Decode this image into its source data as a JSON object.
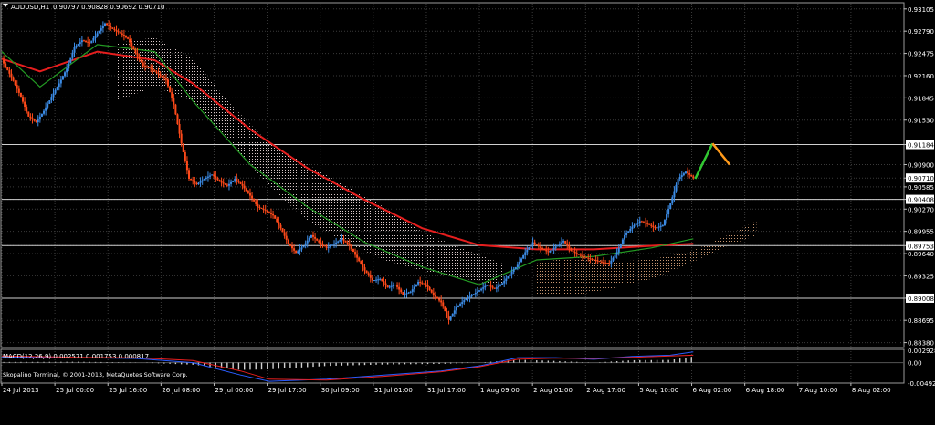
{
  "colors": {
    "background": "#000000",
    "grid": "#3a3a3a",
    "axis_text": "#ffffff",
    "bull_candle": "#3c8ce6",
    "bear_candle": "#ff4a1a",
    "ma_slow": "#e61e1e",
    "ma_fast": "#239b23",
    "ichimoku_cloud_bear": "#d8c8c8",
    "ichimoku_cloud_bull": "#c89670",
    "horizontal_level": "#d0d0d0",
    "macd_line": "#2a5cff",
    "macd_signal": "#e61e1e",
    "macd_histogram": "#d0d0d0",
    "arrow_up": "#20e020",
    "arrow_down": "#e02020",
    "forecast_up": "#32c832",
    "forecast_down": "#ff9a1a"
  },
  "header": {
    "symbol_label": "AUDUSD,H1",
    "ohlc_label": "0.90797 0.90828 0.90692 0.90710",
    "symbol_icon": "triangle-down-icon"
  },
  "footer": {
    "copyright": "Skopalino Terminal, © 2001-2013, MetaQuotes Software Corp."
  },
  "chart_data": [
    {
      "type": "candlestick",
      "symbol": "AUDUSD",
      "timeframe": "H1",
      "price_ticks": [
        "0.93105",
        "0.92790",
        "0.92475",
        "0.92160",
        "0.91845",
        "0.91530",
        "0.91184",
        "0.90900",
        "0.90710",
        "0.90585",
        "0.90408",
        "0.90270",
        "0.89955",
        "0.89753",
        "0.89640",
        "0.89325",
        "0.89008",
        "0.88695",
        "0.88380"
      ],
      "highlighted_ticks": [
        "0.91184",
        "0.90710",
        "0.90408",
        "0.89753",
        "0.89008"
      ],
      "highlighted_tick_colors": [
        "#ffffff",
        "#ffffff",
        "#ffffff",
        "#ffffff",
        "#ffffff"
      ],
      "horizontal_levels": [
        0.91184,
        0.90408,
        0.89753,
        0.89008
      ],
      "ylim": [
        0.8831,
        0.9318
      ],
      "time_ticks": [
        "24 Jul 2013",
        "25 Jul 00:00",
        "25 Jul 16:00",
        "26 Jul 08:00",
        "29 Jul 00:00",
        "29 Jul 17:00",
        "30 Jul 09:00",
        "31 Jul 01:00",
        "31 Jul 17:00",
        "1 Aug 09:00",
        "2 Aug 01:00",
        "2 Aug 17:00",
        "5 Aug 10:00",
        "6 Aug 02:00",
        "6 Aug 18:00",
        "7 Aug 10:00",
        "8 Aug 02:00"
      ],
      "price_path": [
        [
          0,
          0.9238
        ],
        [
          5,
          0.9214
        ],
        [
          10,
          0.9186
        ],
        [
          14,
          0.9158
        ],
        [
          18,
          0.915
        ],
        [
          22,
          0.9166
        ],
        [
          26,
          0.9186
        ],
        [
          30,
          0.9205
        ],
        [
          34,
          0.9226
        ],
        [
          38,
          0.9256
        ],
        [
          42,
          0.9266
        ],
        [
          46,
          0.9262
        ],
        [
          50,
          0.9276
        ],
        [
          54,
          0.929
        ],
        [
          58,
          0.9282
        ],
        [
          62,
          0.9276
        ],
        [
          66,
          0.9268
        ],
        [
          70,
          0.9248
        ],
        [
          74,
          0.923
        ],
        [
          78,
          0.9226
        ],
        [
          82,
          0.9218
        ],
        [
          86,
          0.921
        ],
        [
          90,
          0.9175
        ],
        [
          94,
          0.912
        ],
        [
          98,
          0.907
        ],
        [
          102,
          0.9062
        ],
        [
          106,
          0.907
        ],
        [
          110,
          0.9076
        ],
        [
          114,
          0.9066
        ],
        [
          118,
          0.906
        ],
        [
          122,
          0.907
        ],
        [
          126,
          0.906
        ],
        [
          130,
          0.9046
        ],
        [
          134,
          0.903
        ],
        [
          138,
          0.9025
        ],
        [
          142,
          0.9018
        ],
        [
          146,
          0.9
        ],
        [
          150,
          0.8978
        ],
        [
          154,
          0.8965
        ],
        [
          158,
          0.8975
        ],
        [
          162,
          0.899
        ],
        [
          166,
          0.898
        ],
        [
          170,
          0.8972
        ],
        [
          174,
          0.8978
        ],
        [
          178,
          0.8985
        ],
        [
          182,
          0.8975
        ],
        [
          186,
          0.8958
        ],
        [
          190,
          0.894
        ],
        [
          194,
          0.8926
        ],
        [
          198,
          0.8928
        ],
        [
          202,
          0.8916
        ],
        [
          206,
          0.892
        ],
        [
          210,
          0.8906
        ],
        [
          214,
          0.891
        ],
        [
          218,
          0.8924
        ],
        [
          222,
          0.892
        ],
        [
          226,
          0.8905
        ],
        [
          230,
          0.8895
        ],
        [
          234,
          0.887
        ],
        [
          238,
          0.8888
        ],
        [
          242,
          0.8898
        ],
        [
          246,
          0.8905
        ],
        [
          250,
          0.8912
        ],
        [
          254,
          0.892
        ],
        [
          258,
          0.8914
        ],
        [
          262,
          0.8922
        ],
        [
          266,
          0.8935
        ],
        [
          270,
          0.8948
        ],
        [
          274,
          0.8966
        ],
        [
          278,
          0.898
        ],
        [
          282,
          0.8972
        ],
        [
          286,
          0.8966
        ],
        [
          290,
          0.8974
        ],
        [
          294,
          0.8982
        ],
        [
          298,
          0.8968
        ],
        [
          302,
          0.8962
        ],
        [
          306,
          0.8958
        ],
        [
          310,
          0.8955
        ],
        [
          314,
          0.8952
        ],
        [
          318,
          0.895
        ],
        [
          322,
          0.8966
        ],
        [
          326,
          0.899
        ],
        [
          330,
          0.9002
        ],
        [
          334,
          0.901
        ],
        [
          338,
          0.9006
        ],
        [
          342,
          0.9
        ],
        [
          346,
          0.9004
        ],
        [
          350,
          0.9035
        ],
        [
          354,
          0.907
        ],
        [
          358,
          0.908
        ],
        [
          362,
          0.9071
        ]
      ],
      "ma_slow": [
        [
          0,
          0.924
        ],
        [
          20,
          0.9222
        ],
        [
          50,
          0.925
        ],
        [
          80,
          0.9238
        ],
        [
          100,
          0.9205
        ],
        [
          130,
          0.914
        ],
        [
          160,
          0.9085
        ],
        [
          190,
          0.904
        ],
        [
          220,
          0.9
        ],
        [
          250,
          0.8976
        ],
        [
          280,
          0.897
        ],
        [
          310,
          0.897
        ],
        [
          340,
          0.8975
        ],
        [
          362,
          0.8978
        ]
      ],
      "ma_fast": [
        [
          0,
          0.925
        ],
        [
          20,
          0.92
        ],
        [
          50,
          0.926
        ],
        [
          80,
          0.925
        ],
        [
          100,
          0.918
        ],
        [
          130,
          0.909
        ],
        [
          160,
          0.903
        ],
        [
          190,
          0.898
        ],
        [
          220,
          0.8945
        ],
        [
          250,
          0.892
        ],
        [
          280,
          0.8955
        ],
        [
          310,
          0.896
        ],
        [
          340,
          0.8972
        ],
        [
          362,
          0.8985
        ]
      ],
      "cloud_upper": [
        [
          60,
          0.9262
        ],
        [
          80,
          0.927
        ],
        [
          100,
          0.924
        ],
        [
          120,
          0.9175
        ],
        [
          140,
          0.912
        ],
        [
          160,
          0.909
        ],
        [
          180,
          0.906
        ],
        [
          200,
          0.903
        ],
        [
          220,
          0.8995
        ],
        [
          240,
          0.8972
        ],
        [
          262,
          0.895
        ],
        [
          280,
          0.895
        ],
        [
          300,
          0.896
        ],
        [
          320,
          0.8952
        ],
        [
          340,
          0.8956
        ],
        [
          360,
          0.8966
        ],
        [
          380,
          0.899
        ],
        [
          395,
          0.901
        ]
      ],
      "cloud_lower": [
        [
          60,
          0.918
        ],
        [
          80,
          0.92
        ],
        [
          100,
          0.918
        ],
        [
          120,
          0.912
        ],
        [
          140,
          0.906
        ],
        [
          160,
          0.901
        ],
        [
          180,
          0.898
        ],
        [
          200,
          0.8955
        ],
        [
          220,
          0.894
        ],
        [
          240,
          0.893
        ],
        [
          262,
          0.8918
        ],
        [
          280,
          0.8905
        ],
        [
          300,
          0.8905
        ],
        [
          320,
          0.8915
        ],
        [
          340,
          0.8928
        ],
        [
          360,
          0.895
        ],
        [
          380,
          0.8975
        ],
        [
          395,
          0.899
        ]
      ],
      "forecast_up": [
        [
          363,
          0.907
        ],
        [
          372,
          0.912
        ]
      ],
      "forecast_down": [
        [
          372,
          0.912
        ],
        [
          381,
          0.909
        ]
      ]
    },
    {
      "type": "line",
      "title": "MACD(12,26,9) 0.002571 0.001753 0.000817",
      "indicator": "MACD(12,26,9)",
      "values_label": "0.002571 0.001753 0.000817",
      "y_ticks": [
        "0.002928",
        "0.00",
        "-0.004922"
      ],
      "ylim": [
        -0.004922,
        0.0032
      ],
      "macd_line": [
        [
          0,
          0.0014
        ],
        [
          40,
          0.0012
        ],
        [
          70,
          0.001
        ],
        [
          100,
          0.0
        ],
        [
          125,
          -0.003
        ],
        [
          140,
          -0.0045
        ],
        [
          170,
          -0.004
        ],
        [
          200,
          -0.003
        ],
        [
          230,
          -0.002
        ],
        [
          250,
          -0.0008
        ],
        [
          270,
          0.0012
        ],
        [
          290,
          0.0012
        ],
        [
          310,
          0.0008
        ],
        [
          330,
          0.0015
        ],
        [
          350,
          0.0018
        ],
        [
          362,
          0.0026
        ]
      ],
      "signal_line": [
        [
          0,
          0.0016
        ],
        [
          40,
          0.0013
        ],
        [
          70,
          0.0012
        ],
        [
          100,
          0.0005
        ],
        [
          125,
          -0.002
        ],
        [
          140,
          -0.004
        ],
        [
          170,
          -0.0042
        ],
        [
          200,
          -0.0033
        ],
        [
          230,
          -0.0022
        ],
        [
          250,
          -0.001
        ],
        [
          270,
          0.0008
        ],
        [
          290,
          0.0011
        ],
        [
          310,
          0.001
        ],
        [
          330,
          0.0013
        ],
        [
          350,
          0.0016
        ],
        [
          362,
          0.0018
        ]
      ],
      "histogram_bars": 120
    }
  ]
}
